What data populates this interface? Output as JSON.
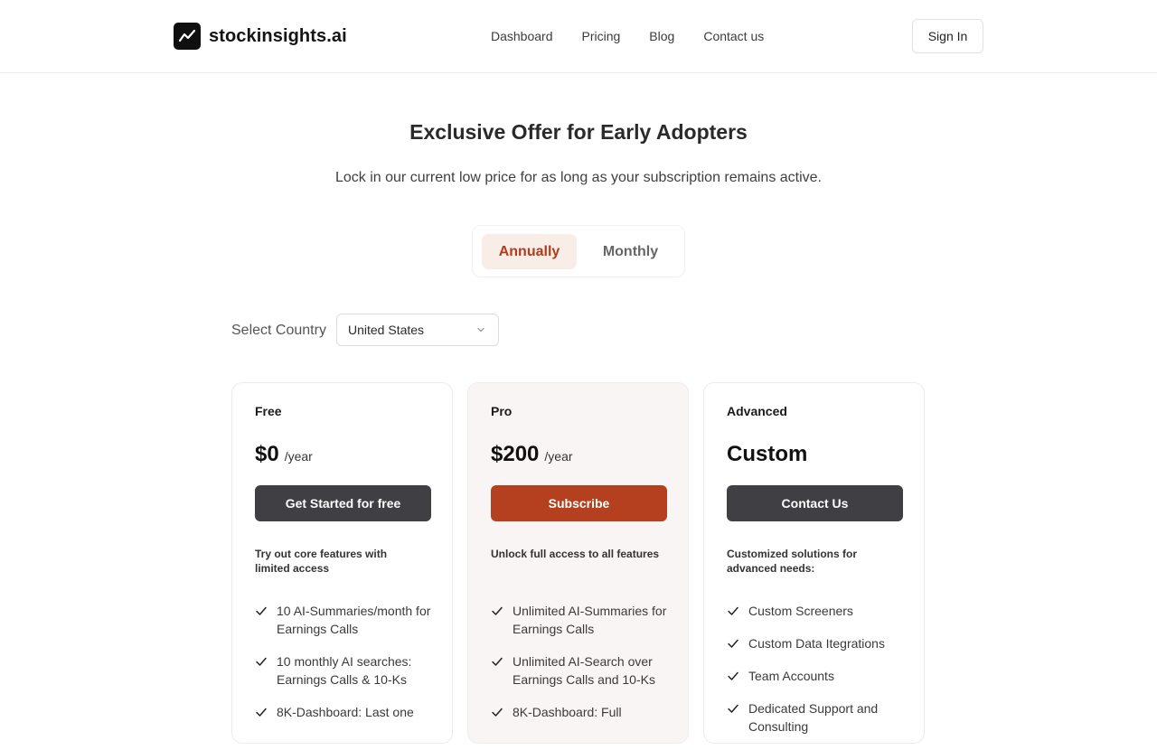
{
  "header": {
    "logo_text": "stockinsights.ai",
    "logo_icon": "trend-line-icon",
    "nav": [
      "Dashboard",
      "Pricing",
      "Blog",
      "Contact us"
    ],
    "signin_label": "Sign In"
  },
  "hero": {
    "title": "Exclusive Offer for Early Adopters",
    "subtitle": "Lock in our current low price for as long as your subscription remains active."
  },
  "billing_toggle": {
    "options": [
      "Annually",
      "Monthly"
    ],
    "selected": "Annually"
  },
  "country": {
    "label": "Select Country",
    "value": "United States"
  },
  "plans": [
    {
      "name": "Free",
      "price": "$0",
      "period": "/year",
      "cta": "Get Started for free",
      "description": "Try out core features with limited access",
      "features": [
        "10 AI-Summaries/month for Earnings Calls",
        "10 monthly AI searches: Earnings Calls & 10-Ks",
        "8K-Dashboard: Last one"
      ]
    },
    {
      "name": "Pro",
      "price": "$200",
      "period": "/year",
      "cta": "Subscribe",
      "description": "Unlock full access to all features",
      "features": [
        "Unlimited AI-Summaries for Earnings Calls",
        "Unlimited AI-Search over Earnings Calls and 10-Ks",
        "8K-Dashboard: Full"
      ]
    },
    {
      "name": "Advanced",
      "price": "Custom",
      "period": "",
      "cta": "Contact Us",
      "description": "Customized solutions for advanced needs:",
      "features": [
        "Custom Screeners",
        "Custom Data Itegrations",
        "Team Accounts",
        "Dedicated Support and Consulting"
      ]
    }
  ],
  "colors": {
    "accent": "#b4401f",
    "toggle_active_bg": "#f9ede8",
    "dark_button": "#3f3f44",
    "pro_card_bg": "#f9f5f4"
  }
}
